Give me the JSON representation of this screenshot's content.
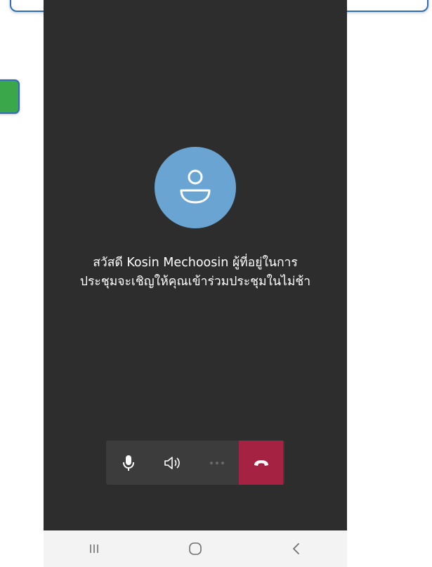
{
  "call": {
    "message_line1": "สวัสดี Kosin Mechoosin ผู้ที่อยู่ในการ",
    "message_line2": "ประชุมจะเชิญให้คุณเข้าร่วมประชุมในไม่ช้า"
  },
  "toolbar": {
    "buttons": [
      "microphone-icon",
      "speaker-icon",
      "more-icon",
      "hangup-icon"
    ]
  },
  "navbar": {
    "buttons": [
      "recent-apps-icon",
      "home-icon",
      "back-icon"
    ]
  },
  "colors": {
    "background": "#2d2d2d",
    "avatar": "#6aa4d2",
    "hangup": "#a52242",
    "navbar": "#f3f3f3"
  }
}
